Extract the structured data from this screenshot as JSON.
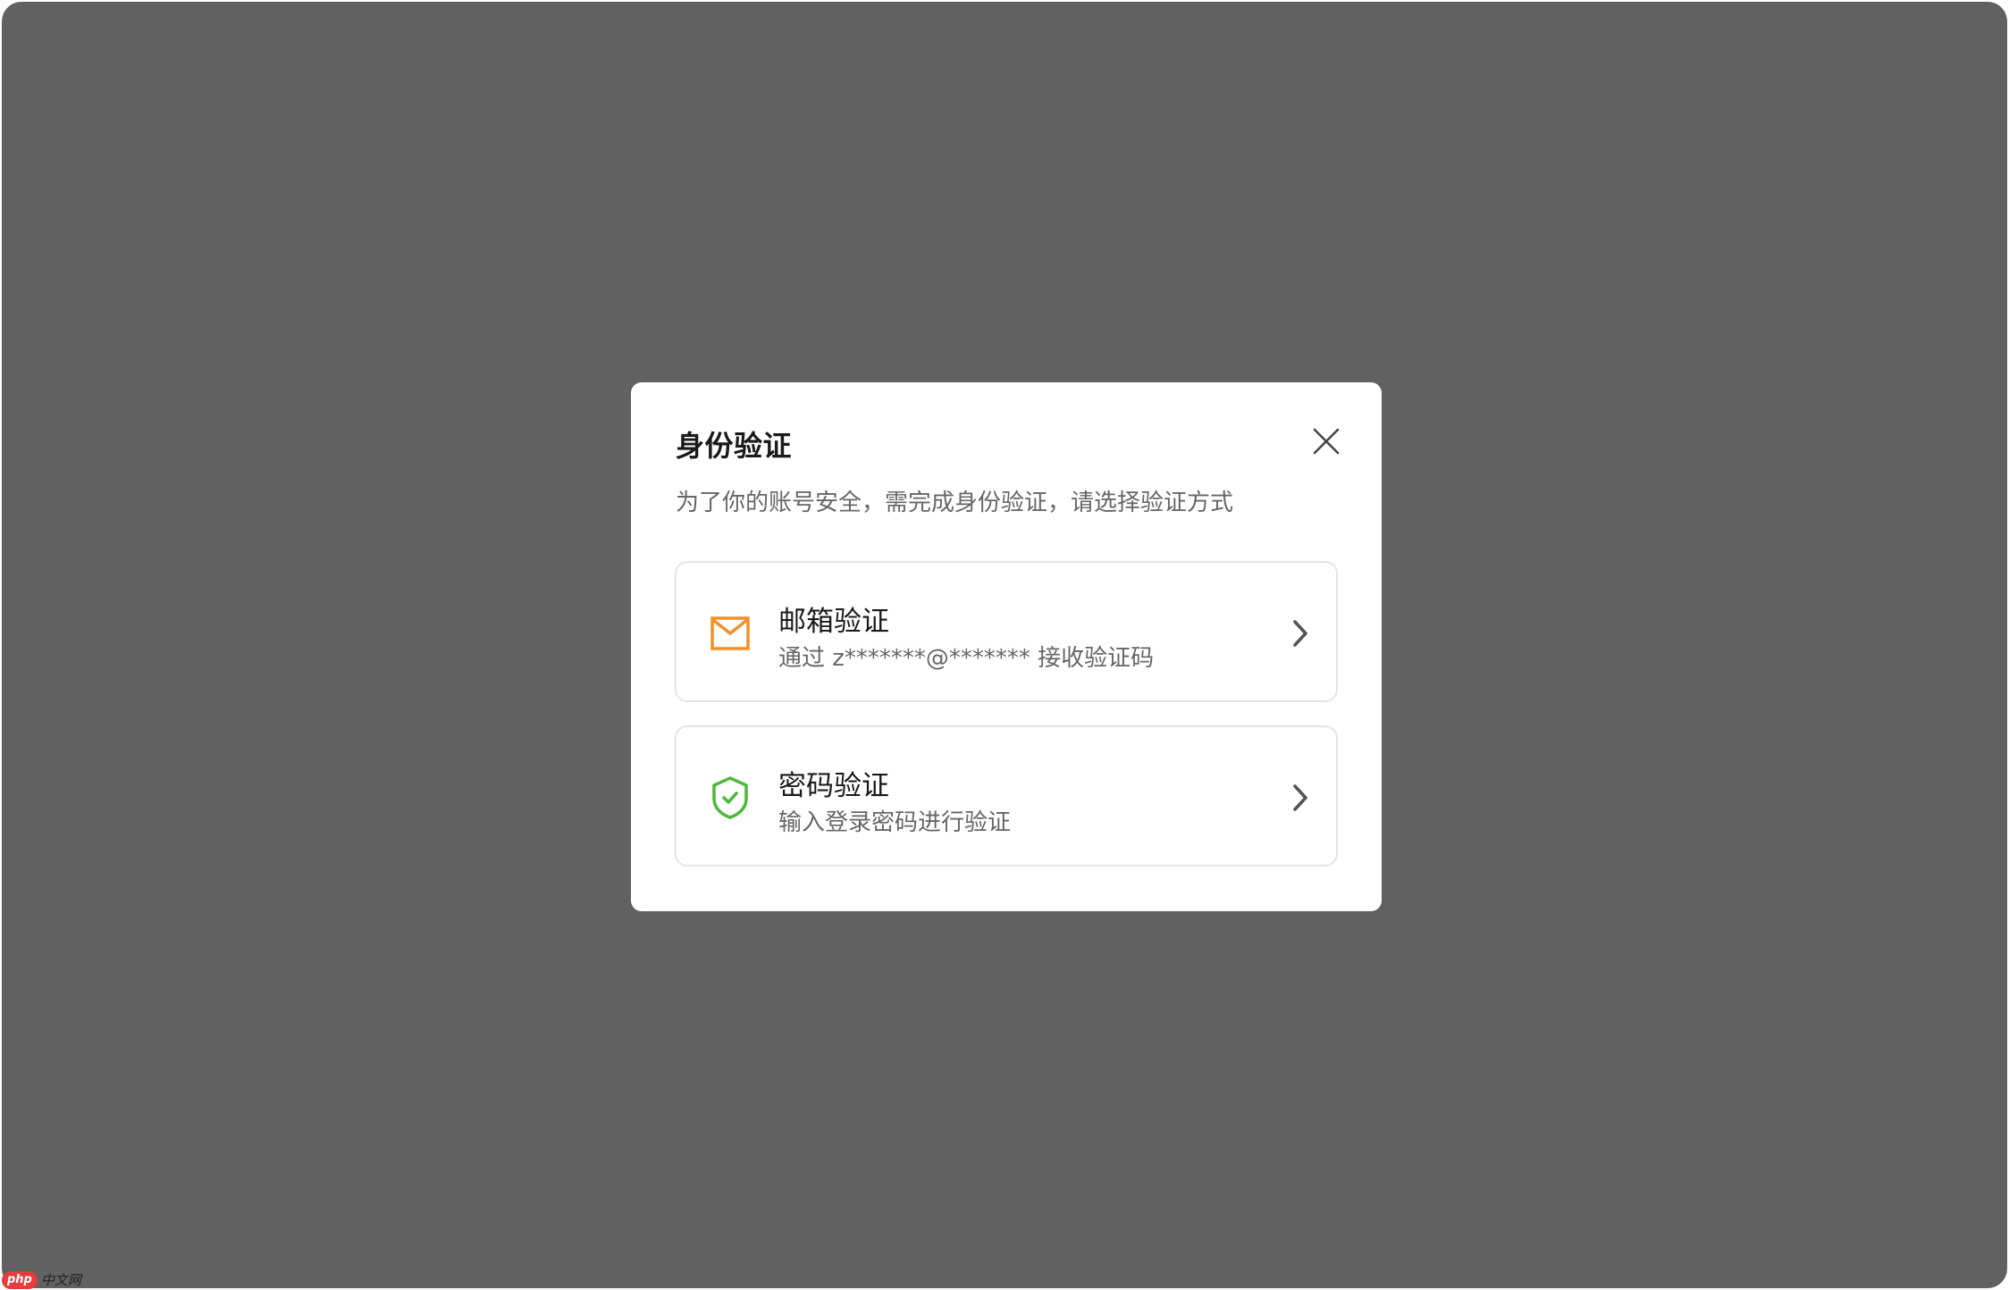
{
  "dialog": {
    "title": "身份验证",
    "subtitle": "为了你的账号安全，需完成身份验证，请选择验证方式",
    "close_icon": "close-icon"
  },
  "options": [
    {
      "title": "邮箱验证",
      "description": "通过 z*******@******* 接收验证码",
      "icon": "mail-icon",
      "icon_color": "#f0902c"
    },
    {
      "title": "密码验证",
      "description": "输入登录密码进行验证",
      "icon": "shield-check-icon",
      "icon_color": "#52b83f"
    }
  ],
  "watermark": {
    "badge": "php",
    "text": "中文网"
  },
  "colors": {
    "overlay": "#616161",
    "dialog_bg": "#ffffff",
    "border": "#e5e5e5",
    "title": "#1a1a1a",
    "secondary_text": "#666666"
  }
}
